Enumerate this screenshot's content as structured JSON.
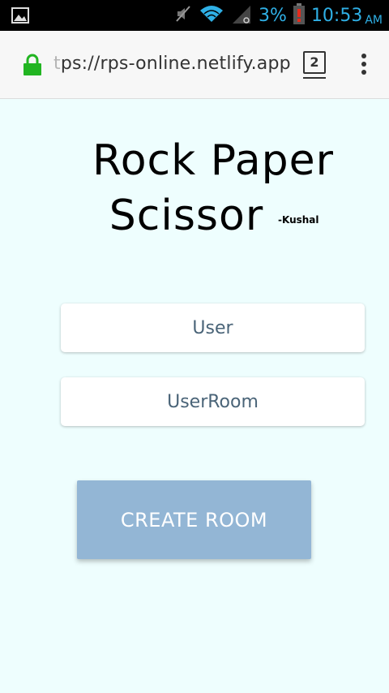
{
  "status_bar": {
    "battery_percent": "3%",
    "time": "10:53",
    "ampm": "AM",
    "accent_color": "#2fb0e6",
    "icons": [
      "gallery-icon",
      "mute-icon",
      "wifi-icon",
      "signal-icon",
      "battery-low-icon"
    ]
  },
  "browser": {
    "url_scheme": "t",
    "url_rest": "ps://rps-online.netlify.app",
    "tab_count": "2",
    "lock_color": "#22b522"
  },
  "page": {
    "title_line1": "Rock Paper",
    "title_line2": "Scissor",
    "author": "-Kushal",
    "user_placeholder": "User",
    "room_placeholder": "UserRoom",
    "create_button": "CREATE ROOM",
    "background_color": "#eefefe",
    "button_color": "#93b6d5"
  }
}
